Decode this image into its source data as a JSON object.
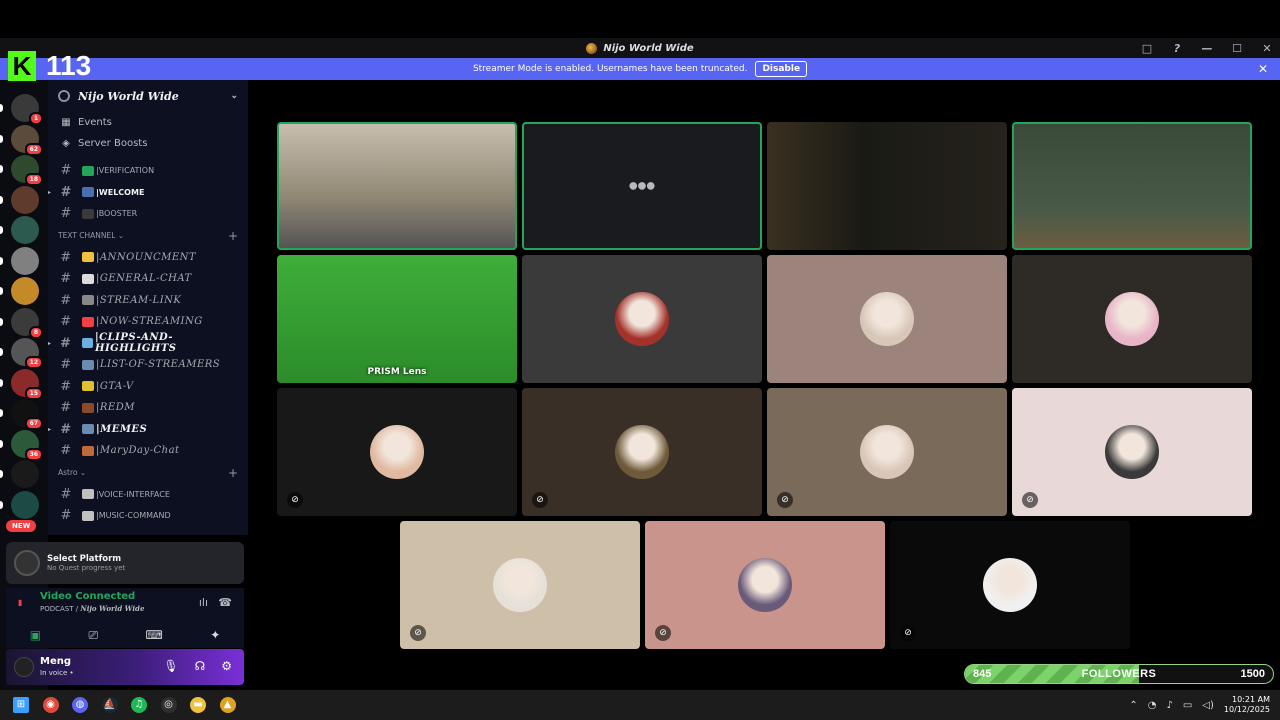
{
  "window": {
    "title": "Nijo World Wide",
    "controls": [
      "□",
      "?",
      "—",
      "☐",
      "✕"
    ]
  },
  "overlay": {
    "kick_logo": "K",
    "viewer_count": "113"
  },
  "banner": {
    "text": "Streamer Mode is enabled. Usernames have been truncated.",
    "button": "Disable",
    "close": "✕"
  },
  "guilds": [
    {
      "badge": "1",
      "color": "#3a3a3a"
    },
    {
      "badge": "62",
      "color": "#5b4b3a"
    },
    {
      "badge": "18",
      "color": "#2e4a2e"
    },
    {
      "badge": "",
      "color": "#5e3b2a"
    },
    {
      "badge": "",
      "color": "#2c5a4e"
    },
    {
      "badge": "",
      "color": "#808080"
    },
    {
      "badge": "",
      "color": "#c48a2a"
    },
    {
      "badge": "8",
      "color": "#3b3b3b"
    },
    {
      "badge": "12",
      "color": "#555555"
    },
    {
      "badge": "15",
      "color": "#8a2a2a"
    },
    {
      "badge": "67",
      "color": "#111111"
    },
    {
      "badge": "36",
      "color": "#2a5a3a"
    },
    {
      "badge": "",
      "color": "#1a1a1a"
    },
    {
      "badge": "",
      "color": "#1c4a44"
    }
  ],
  "guild_new_badge": "NEW",
  "sidebar": {
    "server_name": "Nijo World Wide",
    "events": "Events",
    "boosts": "Server Boosts",
    "channels_top": [
      {
        "emoji_color": "#23a55a",
        "name": "|VERIFICATION",
        "bold": false
      },
      {
        "emoji_color": "#4a6fb0",
        "name": "|WELCOME",
        "bold": true
      },
      {
        "emoji_color": "#3a3a3a",
        "name": "|BOOSTER",
        "bold": false
      }
    ],
    "category_text": "TEXT CHANNEL",
    "channels_text": [
      {
        "emoji_color": "#f0c040",
        "name": "|ANNOUNCMENT",
        "bold": false
      },
      {
        "emoji_color": "#dcdcdc",
        "name": "|GENERAL-CHAT",
        "bold": false
      },
      {
        "emoji_color": "#888888",
        "name": "|STREAM-LINK",
        "bold": false
      },
      {
        "emoji_color": "#f23f43",
        "name": "|NOW-STREAMING",
        "bold": false
      },
      {
        "emoji_color": "#6ab0e0",
        "name": "|CLIPS-AND-HIGHLIGHTS",
        "bold": true
      },
      {
        "emoji_color": "#6a8ab0",
        "name": "|LIST-OF-STREAMERS",
        "bold": false
      },
      {
        "emoji_color": "#e0c030",
        "name": "|GTA-V",
        "bold": false
      },
      {
        "emoji_color": "#8a4a2a",
        "name": "|REDM",
        "bold": false
      },
      {
        "emoji_color": "#6a8ab0",
        "name": "|MEMES",
        "bold": true
      },
      {
        "emoji_color": "#c06a3a",
        "name": "|MaryDay-Chat",
        "bold": false
      }
    ],
    "category_voice": "Astro",
    "channels_voice": [
      {
        "emoji_color": "#c0c0c0",
        "name": "|VOICE-INTERFACE"
      },
      {
        "emoji_color": "#c0c0c0",
        "name": "|MUSIC-COMMAND"
      }
    ]
  },
  "quest": {
    "title": "Select Platform",
    "subtitle": "No Quest progress yet"
  },
  "voice": {
    "status": "Video Connected",
    "channel": "PODCAST / ",
    "server": "Nijo World Wide",
    "buttons": [
      "▣",
      "⎚",
      "⌨",
      "✦"
    ]
  },
  "user": {
    "name": "Meng",
    "status": "In voice •"
  },
  "tiles": [
    {
      "label": "",
      "bg": "linear-gradient(180deg,#c7bfae,#8f8673 60%,#555 100%)",
      "speaking": true,
      "avatar": "",
      "muted": false
    },
    {
      "label": "",
      "bg": "#1a1b1e",
      "speaking": true,
      "avatar": "",
      "muted": false,
      "loading": true
    },
    {
      "label": "",
      "bg": "linear-gradient(90deg,#3a3020,#1a1a14 40%,#26221c)",
      "speaking": false,
      "avatar": "",
      "muted": false
    },
    {
      "label": "",
      "bg": "linear-gradient(180deg,#3a4a3a,#4a5a48 70%,#6b5d40)",
      "speaking": true,
      "avatar": "",
      "muted": false
    },
    {
      "label": "PRISM Lens",
      "bg": "linear-gradient(180deg,#3fae3a,#2c8c2a)",
      "speaking": false,
      "avatar": "",
      "muted": false
    },
    {
      "label": "",
      "bg": "#3b3a3a",
      "speaking": false,
      "avatar": "#a3322a",
      "muted": false
    },
    {
      "label": "",
      "bg": "#9c847c",
      "speaking": false,
      "avatar": "#d7c7b8",
      "muted": false
    },
    {
      "label": "",
      "bg": "#2e2a26",
      "speaking": false,
      "avatar": "#e8b4c8",
      "muted": false
    },
    {
      "label": "",
      "bg": "#181818",
      "speaking": false,
      "avatar": "#e0b9a0",
      "muted": true
    },
    {
      "label": "",
      "bg": "#3a2f26",
      "speaking": false,
      "avatar": "#6e5a3a",
      "muted": true
    },
    {
      "label": "",
      "bg": "#7a6a5a",
      "speaking": false,
      "avatar": "#d9c6b8",
      "muted": true
    },
    {
      "label": "",
      "bg": "#e9d8d8",
      "speaking": false,
      "avatar": "#3a3a3a",
      "muted": true
    },
    {
      "label": "",
      "bg": "#cdbfa8",
      "speaking": false,
      "avatar": "#e6e0d8",
      "muted": true
    },
    {
      "label": "",
      "bg": "#c8948c",
      "speaking": false,
      "avatar": "#6a5a7a",
      "muted": true
    },
    {
      "label": "",
      "bg": "#0a0a0a",
      "speaking": false,
      "avatar": "#f0f0f0",
      "muted": true
    }
  ],
  "followers": {
    "current": 845,
    "goal": 1500,
    "label": "FOLLOWERS",
    "current_label": "845",
    "goal_label": "1500"
  },
  "taskbar": {
    "apps": [
      {
        "name": "windows-start-icon",
        "color": "#3aa0ff",
        "glyph": "⊞"
      },
      {
        "name": "chrome-icon",
        "color": "#e04a3a",
        "glyph": "◉"
      },
      {
        "name": "discord-icon",
        "color": "#5865f2",
        "glyph": "◍"
      },
      {
        "name": "steam-icon",
        "color": "#1b2838",
        "glyph": "⛵"
      },
      {
        "name": "spotify-icon",
        "color": "#1db954",
        "glyph": "♫"
      },
      {
        "name": "obs-icon",
        "color": "#302e31",
        "glyph": "◎"
      },
      {
        "name": "folder-icon",
        "color": "#f0c040",
        "glyph": "▬"
      },
      {
        "name": "game-launcher-icon",
        "color": "#e0a020",
        "glyph": "▲"
      }
    ],
    "time": "10:21 AM",
    "date": "10/12/2025"
  }
}
